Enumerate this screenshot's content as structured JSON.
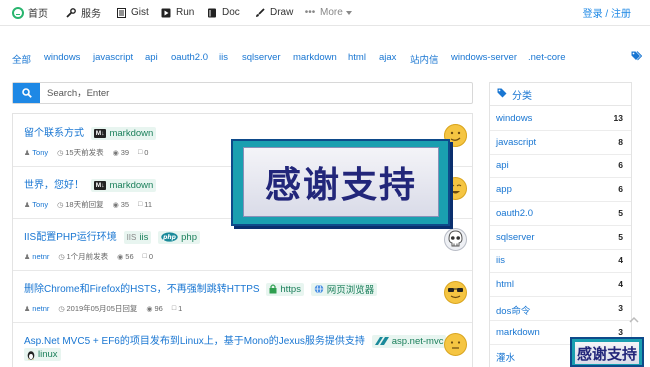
{
  "nav": {
    "items": [
      {
        "label": "首页",
        "icon": "logo-icon"
      },
      {
        "label": "服务",
        "icon": "wrench-icon"
      },
      {
        "label": "Gist",
        "icon": "file-icon"
      },
      {
        "label": "Run",
        "icon": "play-icon"
      },
      {
        "label": "Doc",
        "icon": "book-icon"
      },
      {
        "label": "Draw",
        "icon": "brush-icon"
      },
      {
        "label": "More",
        "icon": "ellipsis-icon"
      }
    ],
    "login": "登录 / 注册"
  },
  "tags": [
    "全部",
    "windows",
    "javascript",
    "api",
    "oauth2.0",
    "iis",
    "sqlserver",
    "markdown",
    "html",
    "ajax",
    "站内信",
    "windows-server",
    ".net-core"
  ],
  "search": {
    "placeholder": "Search，Enter",
    "value": ""
  },
  "articles": [
    {
      "title": "留个联系方式",
      "badges": [
        {
          "icon": "markdown-icon",
          "label": "markdown"
        }
      ],
      "author": "Tony",
      "time": "15天前发表",
      "views": "39",
      "comments": "0",
      "avatar_color": "#f5c542"
    },
    {
      "title": "世界，您好！",
      "badges": [
        {
          "icon": "markdown-icon",
          "label": "markdown"
        }
      ],
      "author": "Tony",
      "time": "18天前回复",
      "views": "35",
      "comments": "11",
      "avatar_color": "#f5c542"
    },
    {
      "title": "IIS配置PHP运行环境",
      "badges": [
        {
          "icon": "iis-icon",
          "label": "iis"
        },
        {
          "icon": "php-icon",
          "label": "php"
        }
      ],
      "author": "netnr",
      "time": "1个月前发表",
      "views": "56",
      "comments": "0",
      "avatar_color": "#dfe3ea"
    },
    {
      "title": "删除Chrome和Firefox的HSTS，不再强制跳转HTTPS",
      "badges": [
        {
          "icon": "lock-icon",
          "label": "https"
        },
        {
          "icon": "globe-icon",
          "label": "网页浏览器"
        }
      ],
      "author": "netnr",
      "time": "2019年05月05日回复",
      "views": "96",
      "comments": "1",
      "avatar_color": "#f5c542"
    },
    {
      "title": "Asp.Net MVC5 + EF6的项目发布到Linux上，基于Mono的Jexus服务提供支持",
      "badges": [
        {
          "icon": "azure-icon",
          "label": "asp.net-mvc"
        },
        {
          "icon": "linux-icon",
          "label": "linux"
        }
      ],
      "author": "",
      "time": "",
      "views": "",
      "comments": "",
      "avatar_color": "#f5c542"
    }
  ],
  "sidebar": {
    "title": "分类",
    "categories": [
      {
        "name": "windows",
        "count": "13"
      },
      {
        "name": "javascript",
        "count": "8"
      },
      {
        "name": "api",
        "count": "6"
      },
      {
        "name": "app",
        "count": "6"
      },
      {
        "name": "oauth2.0",
        "count": "5"
      },
      {
        "name": "sqlserver",
        "count": "5"
      },
      {
        "name": "iis",
        "count": "4"
      },
      {
        "name": "html",
        "count": "4"
      },
      {
        "name": "dos命令",
        "count": "3"
      },
      {
        "name": "markdown",
        "count": "3"
      },
      {
        "name": "灌水",
        "count": ""
      }
    ]
  },
  "overlays": {
    "big_text": "感谢支持",
    "small_text": "感谢支持"
  },
  "colors": {
    "link": "#1976d2",
    "accent": "#1e88e5",
    "badge_bg": "#e8f5f0",
    "overlay_frame": "#1a9fb0"
  }
}
